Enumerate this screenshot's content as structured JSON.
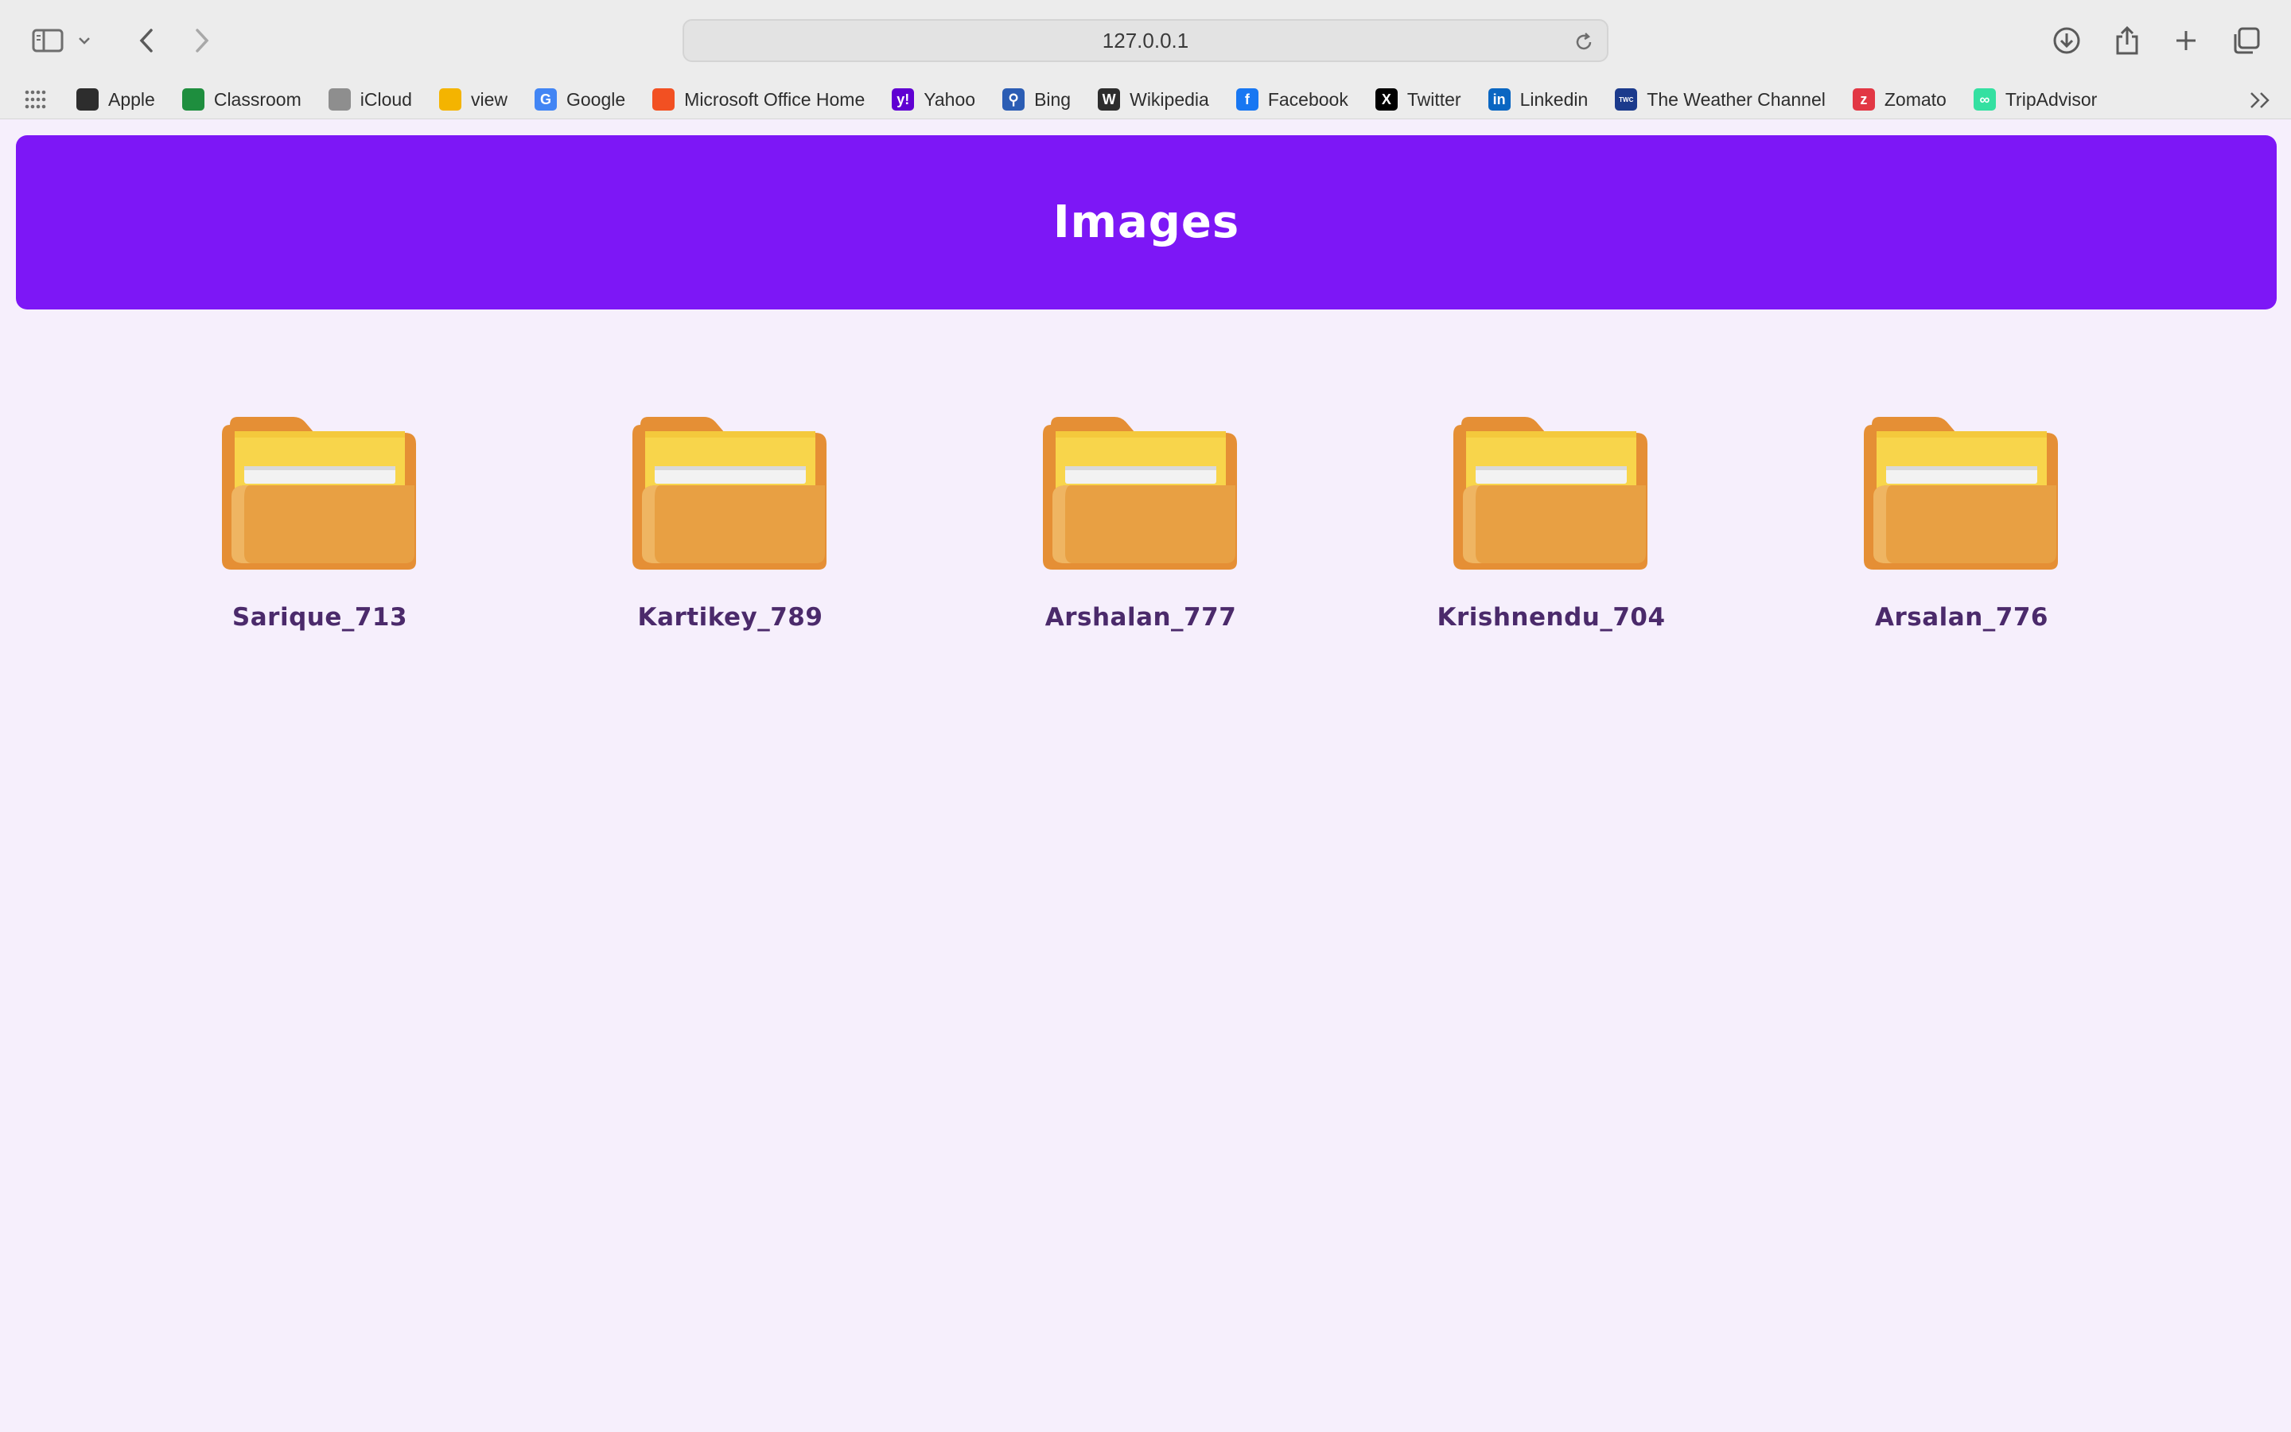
{
  "browser": {
    "url": "127.0.0.1",
    "bookmarks": [
      {
        "label": "Apple",
        "icon": "apple-icon",
        "color": "#2d2d2d",
        "glyph": ""
      },
      {
        "label": "Classroom",
        "icon": "classroom-icon",
        "color": "#1e8e3e",
        "glyph": ""
      },
      {
        "label": "iCloud",
        "icon": "icloud-icon",
        "color": "#8e8e8e",
        "glyph": ""
      },
      {
        "label": "view",
        "icon": "google-drive-icon",
        "color": "#f4b400",
        "glyph": ""
      },
      {
        "label": "Google",
        "icon": "google-icon",
        "color": "#4285f4",
        "glyph": "G"
      },
      {
        "label": "Microsoft Office Home",
        "icon": "microsoft-icon",
        "color": "#f25022",
        "glyph": ""
      },
      {
        "label": "Yahoo",
        "icon": "yahoo-icon",
        "color": "#6001d2",
        "glyph": "y!"
      },
      {
        "label": "Bing",
        "icon": "bing-search-icon",
        "color": "#2b5db4",
        "glyph": "⚲"
      },
      {
        "label": "Wikipedia",
        "icon": "wikipedia-icon",
        "color": "#2d2d2d",
        "glyph": "W"
      },
      {
        "label": "Facebook",
        "icon": "facebook-icon",
        "color": "#1877f2",
        "glyph": "f"
      },
      {
        "label": "Twitter",
        "icon": "x-twitter-icon",
        "color": "#000000",
        "glyph": "X"
      },
      {
        "label": "Linkedin",
        "icon": "linkedin-icon",
        "color": "#0a66c2",
        "glyph": "in"
      },
      {
        "label": "The Weather Channel",
        "icon": "weather-channel-icon",
        "color": "#1b3a8c",
        "glyph": "TWC"
      },
      {
        "label": "Zomato",
        "icon": "zomato-icon",
        "color": "#e23744",
        "glyph": "z"
      },
      {
        "label": "TripAdvisor",
        "icon": "tripadvisor-icon",
        "color": "#34e0a1",
        "glyph": "∞"
      }
    ]
  },
  "page": {
    "title": "Images",
    "folders": [
      {
        "name": "Sarique_713"
      },
      {
        "name": "Kartikey_789"
      },
      {
        "name": "Arshalan_777"
      },
      {
        "name": "Krishnendu_704"
      },
      {
        "name": "Arsalan_776"
      }
    ]
  },
  "colors": {
    "banner": "#7d17f6",
    "background": "#f6effc",
    "folder_label": "#4b2a6b"
  }
}
